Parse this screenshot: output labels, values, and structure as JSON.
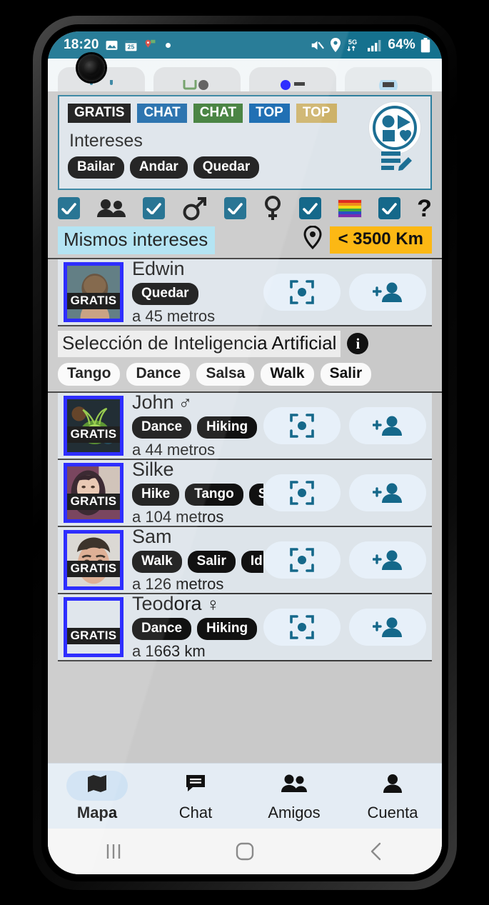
{
  "status_bar": {
    "time": "18:20",
    "left_icons": [
      "photo-icon",
      "calendar-25-icon",
      "location-message-icon",
      "dot-icon"
    ],
    "right_icons": [
      "mute-icon",
      "location-icon",
      "5g-icon",
      "signal-icon"
    ],
    "battery_text": "64%",
    "bg_color": "#15718e"
  },
  "top_toolbar": {
    "buttons": [
      "expand-icon",
      "note-icon",
      "pin-icon",
      "card-icon"
    ]
  },
  "profile_card": {
    "badges": [
      {
        "label": "GRATIS",
        "color": "#111111"
      },
      {
        "label": "CHAT",
        "color": "#1a68a8"
      },
      {
        "label": "CHAT",
        "color": "#3a7a33"
      },
      {
        "label": "TOP",
        "color": "#0c63ad"
      },
      {
        "label": "TOP",
        "color": "#cdb269"
      }
    ],
    "interests_label": "Intereses",
    "interest_pills": [
      "Bailar",
      "Andar",
      "Quedar"
    ],
    "logo_name": "app-logo-icon",
    "edit_icon": "edit-list-icon",
    "border_color": "#2e7f9e"
  },
  "filters": {
    "items": [
      {
        "checkbox": true,
        "icon": "people-icon"
      },
      {
        "checkbox": true,
        "icon": "male-icon"
      },
      {
        "checkbox": true,
        "icon": "female-icon"
      },
      {
        "checkbox": true,
        "icon": "rainbow-flag-icon"
      },
      {
        "checkbox": true,
        "icon": "question-mark-icon"
      }
    ],
    "question_mark": "?",
    "checkbox_color": "#15688a"
  },
  "same_interests": {
    "label": "Mismos intereses",
    "chip_color": "#ade2f2",
    "location_icon": "location-pin-icon",
    "distance_label": "< 3500 Km",
    "distance_color": "#fcb814"
  },
  "ai_section": {
    "title": "Selección de Inteligencia Artificial",
    "info_icon": "info-icon",
    "info_glyph": "i",
    "pills": [
      "Tango",
      "Dance",
      "Salsa",
      "Walk",
      "Salir"
    ]
  },
  "users": [
    {
      "name": "Edwin",
      "gender": "",
      "tags": [
        "Quedar"
      ],
      "distance": "a 45 metros",
      "avatar_tag": "GRATIS",
      "avatar_style": "edwin",
      "focus_icon": "center-focus-icon",
      "add_icon": "person-add-icon"
    },
    {
      "name": "John",
      "gender": "♂",
      "tags": [
        "Dance",
        "Hiking"
      ],
      "distance": "a 44 metros",
      "avatar_tag": "GRATIS",
      "avatar_style": "john",
      "focus_icon": "center-focus-icon",
      "add_icon": "person-add-icon"
    },
    {
      "name": "Silke",
      "gender": "",
      "tags": [
        "Hike",
        "Tango",
        "S"
      ],
      "distance": "a 104 metros",
      "avatar_tag": "GRATIS",
      "avatar_style": "silke",
      "focus_icon": "center-focus-icon",
      "add_icon": "person-add-icon"
    },
    {
      "name": "Sam",
      "gender": "",
      "tags": [
        "Walk",
        "Salir",
        "Id"
      ],
      "distance": "a 126 metros",
      "avatar_tag": "GRATIS",
      "avatar_style": "sam",
      "focus_icon": "center-focus-icon",
      "add_icon": "person-add-icon"
    },
    {
      "name": "Teodora",
      "gender": "♀",
      "tags": [
        "Dance",
        "Hiking"
      ],
      "distance": "a 1663 km",
      "avatar_tag": "GRATIS",
      "avatar_style": "empty",
      "focus_icon": "center-focus-icon",
      "add_icon": "person-add-icon"
    }
  ],
  "bottom_nav": {
    "items": [
      {
        "label": "Mapa",
        "icon": "map-icon",
        "active": true
      },
      {
        "label": "Chat",
        "icon": "chat-icon",
        "active": false
      },
      {
        "label": "Amigos",
        "icon": "people-icon",
        "active": false
      },
      {
        "label": "Cuenta",
        "icon": "person-icon",
        "active": false
      }
    ]
  },
  "android_nav": {
    "recents": "recents-icon",
    "home": "home-icon",
    "back": "back-icon"
  }
}
